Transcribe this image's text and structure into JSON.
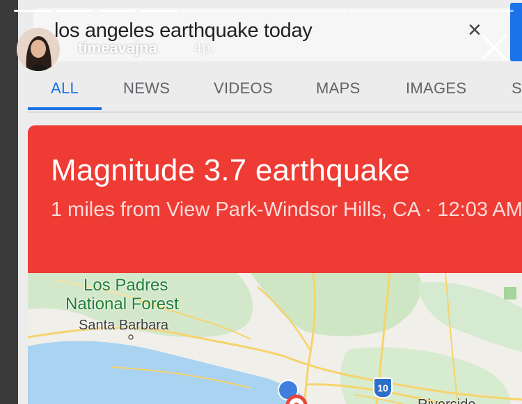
{
  "story": {
    "username": "timeavajna",
    "time": "4p."
  },
  "search": {
    "query": "los angeles earthquake today",
    "clear_glyph": "×"
  },
  "tabs": [
    {
      "label": "ALL",
      "active": true
    },
    {
      "label": "NEWS",
      "active": false
    },
    {
      "label": "VIDEOS",
      "active": false
    },
    {
      "label": "MAPS",
      "active": false
    },
    {
      "label": "IMAGES",
      "active": false
    },
    {
      "label": "S",
      "active": false
    }
  ],
  "earthquake": {
    "title": "Magnitude 3.7 earthquake",
    "subtitle": "1 miles from View Park-Windsor Hills, CA · 12:03 AM"
  },
  "map": {
    "forest_label_line1": "Los Padres",
    "forest_label_line2": "National Forest",
    "city_santa_barbara": "Santa Barbara",
    "city_riverside": "Riverside",
    "highway_10": "10"
  },
  "colors": {
    "accent_blue": "#1a73e8",
    "quake_red": "#ee3b34",
    "ocean": "#aad3f1",
    "land": "#f1efe9",
    "park_green": "#cfe6c5",
    "road_yellow": "#f6d36b"
  }
}
